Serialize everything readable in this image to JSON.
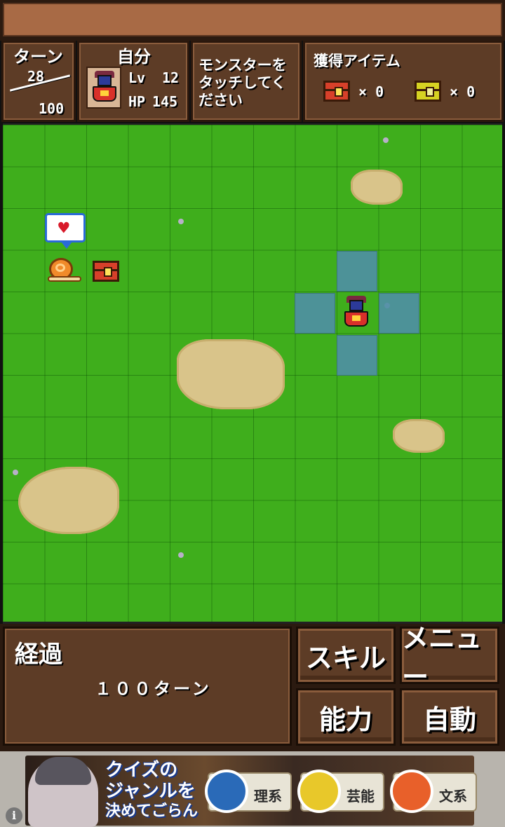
{
  "status": {
    "turn": {
      "label": "ターン",
      "current": "28",
      "max": "100"
    },
    "self": {
      "label": "自分",
      "level_label": "Lv",
      "level": "12",
      "hp_label": "HP",
      "hp": "145"
    },
    "message": "モンスターを\nタッチしてく\nださい",
    "items": {
      "label": "獲得アイテム",
      "red_chest_count": "× 0",
      "yellow_chest_count": "× 0"
    }
  },
  "info": {
    "title": "経過",
    "value": "１００ターン"
  },
  "buttons": {
    "skill": "スキル",
    "menu": "メニュー",
    "ability": "能力",
    "auto": "自動"
  },
  "ad": {
    "headline_1": "クイズの",
    "headline_2": "ジャンルを",
    "headline_3": "決めてごらん",
    "chip_1": "理系",
    "chip_2": "芸能",
    "chip_3": "文系",
    "info_icon": "i"
  },
  "colors": {
    "grass": "#3fae1c",
    "panel": "#5d3c26",
    "move_tile": "#4f8fa6",
    "chest_red": "#d8402a",
    "chest_yellow": "#d6d222"
  }
}
